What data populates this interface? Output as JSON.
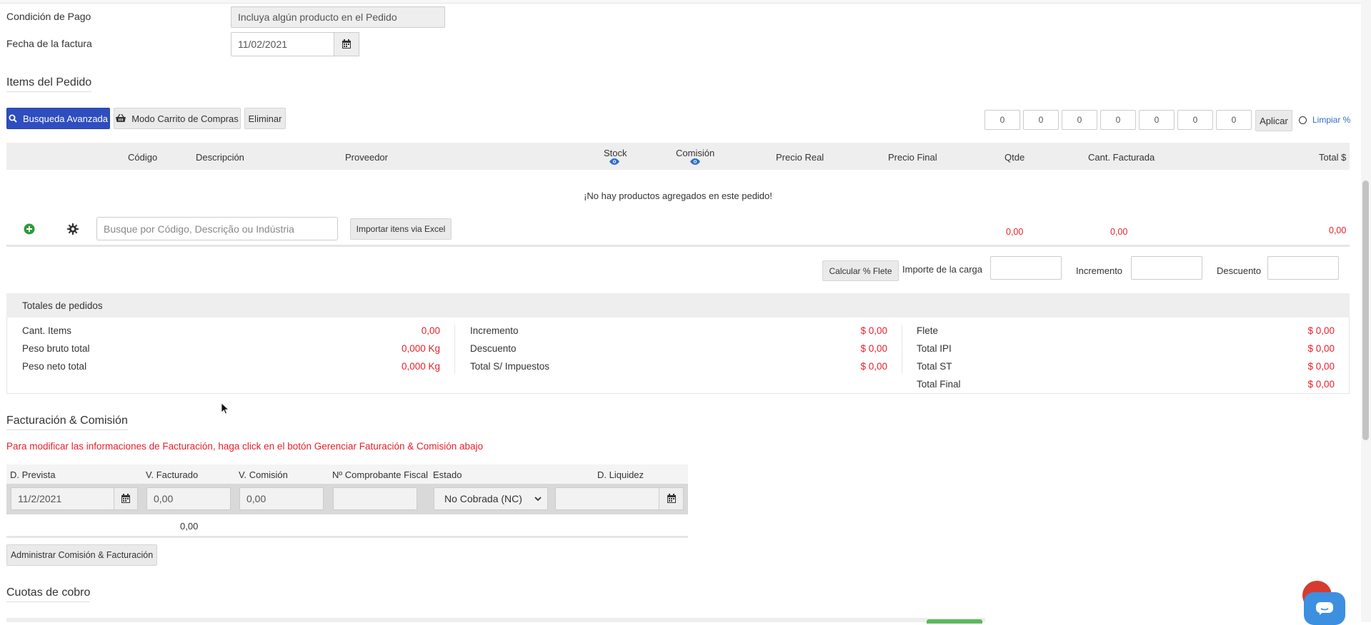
{
  "form": {
    "payment_condition_label": "Condición de Pago",
    "payment_condition_value": "Incluya algún producto en el Pedido",
    "invoice_date_label": "Fecha de la factura",
    "invoice_date_value": "11/02/2021"
  },
  "items_section": {
    "title": "Items del Pedido",
    "btn_advanced_search": "Busqueda Avanzada",
    "btn_cart_mode": "Modo Carrito de Compras",
    "btn_delete": "Eliminar",
    "percent_boxes": [
      "0",
      "0",
      "0",
      "0",
      "0",
      "0",
      "0"
    ],
    "btn_apply": "Aplicar",
    "clear_percent": "Limpiar %",
    "columns": {
      "code": "Código",
      "description": "Descripción",
      "supplier": "Proveedor",
      "stock": "Stock",
      "commission": "Comisión",
      "real_price": "Precio Real",
      "final_price": "Precio Final",
      "qty": "Qtde",
      "billed_qty": "Cant. Facturada",
      "total": "Total $"
    },
    "empty_message": "¡No hay productos agregados en este pedido!",
    "search_placeholder": "Busque por Código, Descrição ou Indústria",
    "btn_import_excel": "Importar itens via Excel",
    "sum_qty": "0,00",
    "sum_billed": "0,00",
    "sum_total": "0,00"
  },
  "freight": {
    "btn_calc": "Calcular % Flete",
    "load_amount_label": "Importe de la carga",
    "increment_label": "Incremento",
    "discount_label": "Descuento"
  },
  "totals": {
    "header": "Totales de pedidos",
    "col1": [
      {
        "label": "Cant. Items",
        "value": "0,00"
      },
      {
        "label": "Peso bruto total",
        "value": "0,000 Kg"
      },
      {
        "label": "Peso neto total",
        "value": "0,000 Kg"
      }
    ],
    "col2": [
      {
        "label": "Incremento",
        "value": "$ 0,00"
      },
      {
        "label": "Descuento",
        "value": "$ 0,00"
      },
      {
        "label": "Total S/ Impuestos",
        "value": "$ 0,00"
      }
    ],
    "col3": [
      {
        "label": "Flete",
        "value": "$ 0,00"
      },
      {
        "label": "Total IPI",
        "value": "$ 0,00"
      },
      {
        "label": "Total ST",
        "value": "$ 0,00"
      },
      {
        "label": "Total Final",
        "value": "$ 0,00"
      }
    ]
  },
  "billing": {
    "title": "Facturación & Comisión",
    "notice": "Para modificar las informaciones de Facturación, haga click en el botón Gerenciar Faturación & Comisión abajo",
    "columns": {
      "expected_date": "D. Prevista",
      "billed_value": "V. Facturado",
      "commission_value": "V. Comisión",
      "fiscal_number": "Nº Comprobante Fiscal",
      "status": "Estado",
      "settlement_date": "D. Liquidez"
    },
    "row": {
      "expected_date": "11/2/2021",
      "billed_value": "0,00",
      "commission_value": "0,00",
      "fiscal_number": "",
      "status": "No Cobrada (NC)",
      "settlement_date": ""
    },
    "sum_billed": "0,00",
    "btn_manage": "Administrar Comisión & Facturación"
  },
  "installments": {
    "title": "Cuotas de cobro"
  },
  "colors": {
    "primary": "#2e4dbf",
    "negative": "#e8202a",
    "add_green": "#2e9a3a",
    "fab_red": "#d63b2f",
    "chat_blue": "#3d8fe0"
  }
}
